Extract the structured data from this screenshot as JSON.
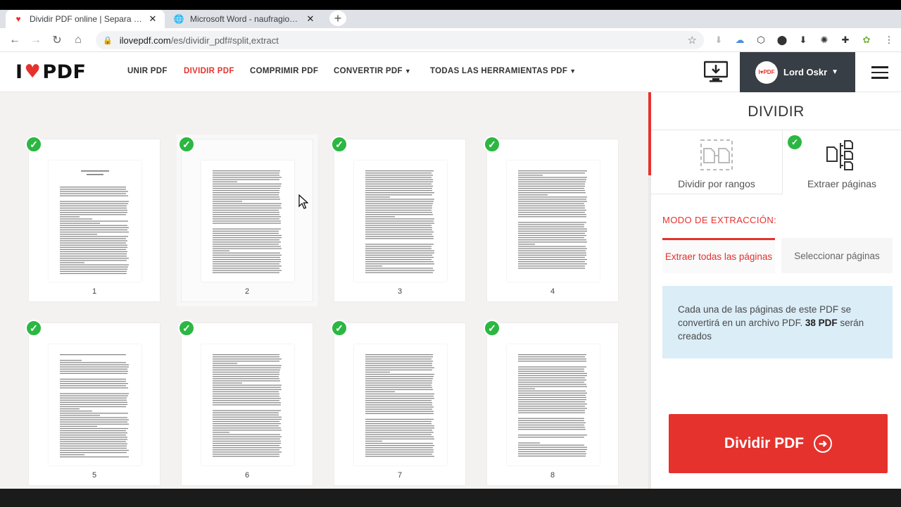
{
  "browser": {
    "tabs": [
      {
        "title": "Dividir PDF online | Separa las p…",
        "active": true
      },
      {
        "title": "Microsoft Word - naufragios.doc",
        "active": false
      }
    ],
    "new_tab": "+",
    "url_domain": "ilovepdf.com",
    "url_path": "/es/dividir_pdf#split,extract"
  },
  "site": {
    "logo": {
      "left": "I",
      "right": "PDF"
    },
    "nav": [
      {
        "label": "UNIR PDF",
        "active": false
      },
      {
        "label": "DIVIDIR PDF",
        "active": true
      },
      {
        "label": "COMPRIMIR PDF",
        "active": false
      },
      {
        "label": "CONVERTIR PDF",
        "active": false,
        "dropdown": true
      },
      {
        "label": "TODAS LAS HERRAMIENTAS PDF",
        "active": false,
        "dropdown": true
      }
    ],
    "user": {
      "name": "Lord Oskr",
      "avatar_text": "I♥PDF"
    }
  },
  "pages": [
    {
      "number": "1"
    },
    {
      "number": "2"
    },
    {
      "number": "3"
    },
    {
      "number": "4"
    },
    {
      "number": "5"
    },
    {
      "number": "6"
    },
    {
      "number": "7"
    },
    {
      "number": "8"
    }
  ],
  "panel": {
    "title": "DIVIDIR",
    "modes": [
      {
        "label": "Dividir por rangos",
        "selected": false
      },
      {
        "label": "Extraer páginas",
        "selected": true
      }
    ],
    "extract_mode_label": "MODO DE EXTRACCIÓN:",
    "options": [
      {
        "label": "Extraer todas las páginas",
        "selected": true
      },
      {
        "label": "Seleccionar páginas",
        "selected": false
      }
    ],
    "info_prefix": "Cada una de las páginas de este PDF se convertirá en un archivo PDF.",
    "info_count": "38 PDF",
    "info_suffix": "serán creados",
    "button_label": "Dividir PDF"
  },
  "colors": {
    "accent": "#e5322d",
    "check": "#2cb742",
    "info_bg": "#dbedf7",
    "user_bg": "#383e45"
  }
}
